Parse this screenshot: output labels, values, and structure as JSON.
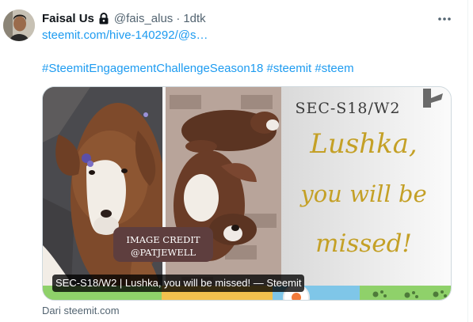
{
  "tweet": {
    "display_name": "Faisal Us",
    "handle": "@fais_alus",
    "separator": "·",
    "time": "1dtk",
    "link_text": "steemit.com/hive-140292/@s…",
    "hashtags": "#SteemitEngagementChallengeSeason18 #steemit #steem",
    "icons": {
      "lock": "lock-icon",
      "more": "more-icon"
    }
  },
  "card": {
    "image_texts": {
      "code": "SEC-S18/W2",
      "line1": "Lushka,",
      "line2": "you will be",
      "line3": "missed!",
      "credit_line1": "IMAGE CREDIT",
      "credit_line2": "@PATJEWELL"
    },
    "title": "SEC-S18/W2 | Lushka, you will be missed! — Steemit",
    "source": "Dari steemit.com"
  },
  "colors": {
    "text_primary": "#0f1419",
    "text_secondary": "#536471",
    "link": "#1d9bf0",
    "border": "#cfd9de",
    "script_gold": "#c4a026",
    "credit_bg": "#5e3e3e"
  }
}
